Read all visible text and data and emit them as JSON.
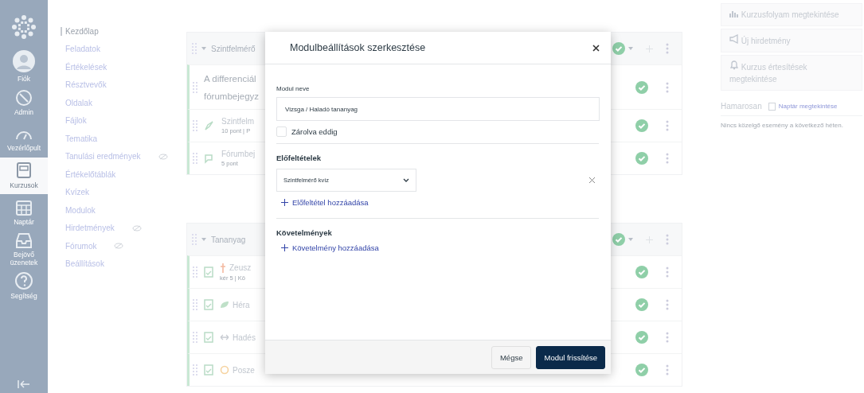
{
  "global_nav": {
    "items": [
      {
        "kind": "logo",
        "selected": false
      },
      {
        "kind": "account",
        "label": "Fiók",
        "selected": false
      },
      {
        "kind": "admin",
        "label": "Admin",
        "selected": false
      },
      {
        "kind": "dashboard",
        "label": "Vezérlőpult",
        "selected": false
      },
      {
        "kind": "courses",
        "label": "Kurzusok",
        "selected": true
      },
      {
        "kind": "calendar",
        "label": "Naptár",
        "selected": false
      },
      {
        "kind": "inbox",
        "label": "Bejövő üzenetek",
        "selected": false
      },
      {
        "kind": "help",
        "label": "Segítség",
        "selected": false
      }
    ]
  },
  "course_nav": {
    "items": [
      {
        "label": "Kezdőlap",
        "selected": true,
        "hidden": false
      },
      {
        "label": "Feladatok",
        "selected": false,
        "hidden": false
      },
      {
        "label": "Értékelések",
        "selected": false,
        "hidden": false
      },
      {
        "label": "Résztvevők",
        "selected": false,
        "hidden": false
      },
      {
        "label": "Oldalak",
        "selected": false,
        "hidden": false
      },
      {
        "label": "Fájlok",
        "selected": false,
        "hidden": false
      },
      {
        "label": "Tematika",
        "selected": false,
        "hidden": false
      },
      {
        "label": "Tanulási eredmények",
        "selected": false,
        "hidden": true
      },
      {
        "label": "Értékelőtáblák",
        "selected": false,
        "hidden": false
      },
      {
        "label": "Kvízek",
        "selected": false,
        "hidden": false
      },
      {
        "label": "Modulok",
        "selected": false,
        "hidden": false
      },
      {
        "label": "Hirdetmények",
        "selected": false,
        "hidden": true
      },
      {
        "label": "Fórumok",
        "selected": false,
        "hidden": true
      },
      {
        "label": "Beállítások",
        "selected": false,
        "hidden": false
      }
    ]
  },
  "modules": [
    {
      "title": "Szintfelmérő",
      "published": true,
      "items": [
        {
          "kind": "header",
          "title": "A differenciál",
          "title_2": "fórumbejegyz",
          "published": true
        },
        {
          "kind": "quiz",
          "title": "Szintfelm",
          "meta": "10 pont | P",
          "published": true
        },
        {
          "kind": "discussion",
          "title": "Fórumbej",
          "meta": "5 pont",
          "published": true
        }
      ]
    },
    {
      "title": "Tananyag",
      "published": true,
      "items": [
        {
          "kind": "assignment",
          "has_indicator": true,
          "title": "Zeusz",
          "meta": "kér 5 | Kö",
          "published": true
        },
        {
          "kind": "assignment",
          "has_indicator": true,
          "title": "Héra",
          "published": true
        },
        {
          "kind": "assignment",
          "has_indicator": true,
          "title": "Hadés",
          "published": true
        },
        {
          "kind": "assignment",
          "has_indicator": true,
          "title": "Posze",
          "published": true
        }
      ]
    }
  ],
  "modal": {
    "title": "Modulbeállítások szerkesztése",
    "name_label": "Modul neve",
    "name_value": "Vizsga / Haladó tananyag",
    "lock_label": "Zárolva eddig",
    "lock_checked": false,
    "prerequisites_heading": "Előfeltételek",
    "prerequisite_select": "Szintfelmérő kvíz",
    "add_prerequisite": "Előfeltétel hozzáadása",
    "requirements_heading": "Követelmények",
    "add_requirement": "Követelmény hozzáadása",
    "cancel": "Mégse",
    "submit": "Modul frissítése"
  },
  "sidebar": {
    "buttons": [
      {
        "kind": "stats",
        "label": "Kurzusfolyam megtekintése"
      },
      {
        "kind": "announce",
        "label": "Új hirdetmény"
      },
      {
        "kind": "bell",
        "label": "Kurzus értesítések megtekintése"
      }
    ],
    "upcoming": {
      "heading": "Hamarosan",
      "calendar_link": "Naptár megtekintése",
      "empty_text": "Nincs közelgő esemény a következő héten."
    }
  }
}
